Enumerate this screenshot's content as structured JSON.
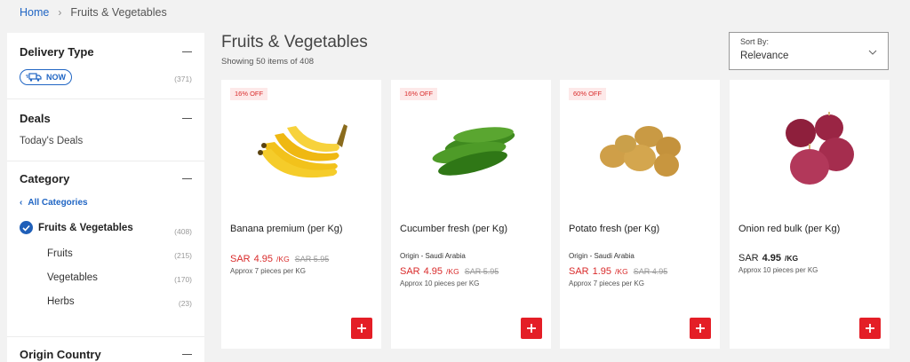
{
  "breadcrumb": {
    "home": "Home",
    "current": "Fruits & Vegetables"
  },
  "filters": {
    "delivery": {
      "title": "Delivery Type",
      "pill": "NOW",
      "count": "(371)"
    },
    "deals": {
      "title": "Deals",
      "link": "Today's Deals"
    },
    "category": {
      "title": "Category",
      "all": "All Categories",
      "selected": {
        "label": "Fruits & Vegetables",
        "count": "(408)"
      },
      "subs": [
        {
          "label": "Fruits",
          "count": "(215)"
        },
        {
          "label": "Vegetables",
          "count": "(170)"
        },
        {
          "label": "Herbs",
          "count": "(23)"
        }
      ]
    },
    "origin": {
      "title": "Origin Country"
    }
  },
  "header": {
    "title": "Fruits & Vegetables",
    "showing": "Showing 50 items of 408"
  },
  "sort": {
    "label": "Sort By:",
    "value": "Relevance"
  },
  "products": [
    {
      "badge": "16% OFF",
      "name": "Banana premium (per Kg)",
      "origin": "",
      "currency": "SAR",
      "price": "4.95",
      "unit": "/KG",
      "old": "SAR 5.95",
      "approx": "Approx 7 pieces per KG"
    },
    {
      "badge": "16% OFF",
      "name": "Cucumber fresh (per Kg)",
      "origin": "Origin - Saudi Arabia",
      "currency": "SAR",
      "price": "4.95",
      "unit": "/KG",
      "old": "SAR 5.95",
      "approx": "Approx 10 pieces per KG"
    },
    {
      "badge": "60% OFF",
      "name": "Potato fresh (per Kg)",
      "origin": "Origin - Saudi Arabia",
      "currency": "SAR",
      "price": "1.95",
      "unit": "/KG",
      "old": "SAR 4.95",
      "approx": "Approx 7 pieces per KG"
    },
    {
      "badge": "",
      "name": "Onion red bulk (per Kg)",
      "origin": "",
      "currency": "SAR",
      "price": "4.95",
      "unit": "/KG",
      "old": "",
      "approx": "Approx 10 pieces per KG"
    }
  ],
  "colors": {
    "accent": "#2166c4",
    "sale": "#d92b2b",
    "add_button": "#e41e26"
  }
}
